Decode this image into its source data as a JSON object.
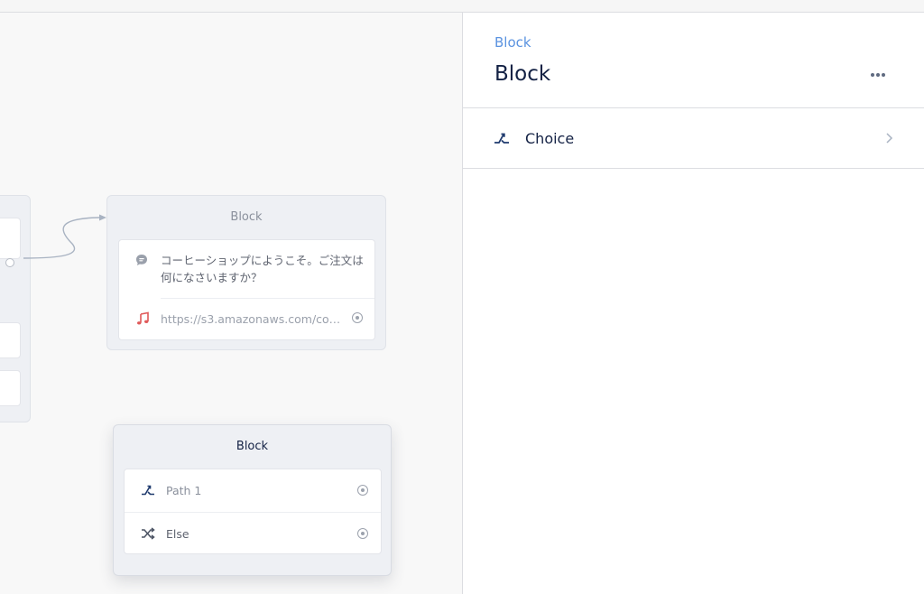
{
  "canvas": {
    "block1": {
      "title": "Block",
      "message_text": "コーヒーショップにようこそ。ご注文は何になさいますか？",
      "audio_url": "https://s3.amazonaws.com/com..."
    },
    "block2": {
      "title": "Block",
      "paths": [
        {
          "label": "Path 1",
          "icon": "path-icon"
        },
        {
          "label": "Else",
          "icon": "shuffle-icon"
        }
      ]
    }
  },
  "panel": {
    "breadcrumb": "Block",
    "title": "Block",
    "more_icon": "more-horizontal-icon",
    "steps": [
      {
        "label": "Choice",
        "icon": "choice-icon"
      }
    ]
  },
  "colors": {
    "accent": "#5b93e0",
    "navy": "#132144",
    "audio_red": "#e05a5a",
    "port_gray": "#9ca2ad"
  }
}
